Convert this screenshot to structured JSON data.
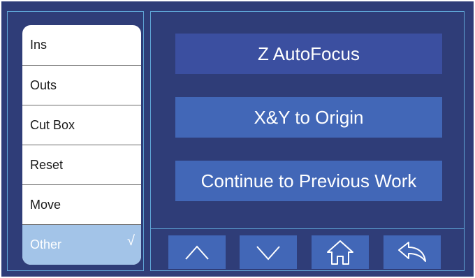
{
  "menu": {
    "items": [
      {
        "label": "Ins"
      },
      {
        "label": "Outs"
      },
      {
        "label": "Cut Box"
      },
      {
        "label": "Reset"
      },
      {
        "label": "Move"
      },
      {
        "label": "Other",
        "selected": true,
        "check_glyph": "√"
      }
    ]
  },
  "actions": {
    "autofocus_label": "Z AutoFocus",
    "origin_label": "X&Y to Origin",
    "continue_label": "Continue to Previous Work"
  },
  "nav": {
    "up_icon": "chevron-up-icon",
    "down_icon": "chevron-down-icon",
    "home_icon": "home-icon",
    "back_icon": "back-arrow-icon"
  },
  "colors": {
    "background": "#2f3d78",
    "panel_border": "#5fa6d6",
    "button": "#4267b7",
    "selected_item": "#a3c4e8"
  }
}
